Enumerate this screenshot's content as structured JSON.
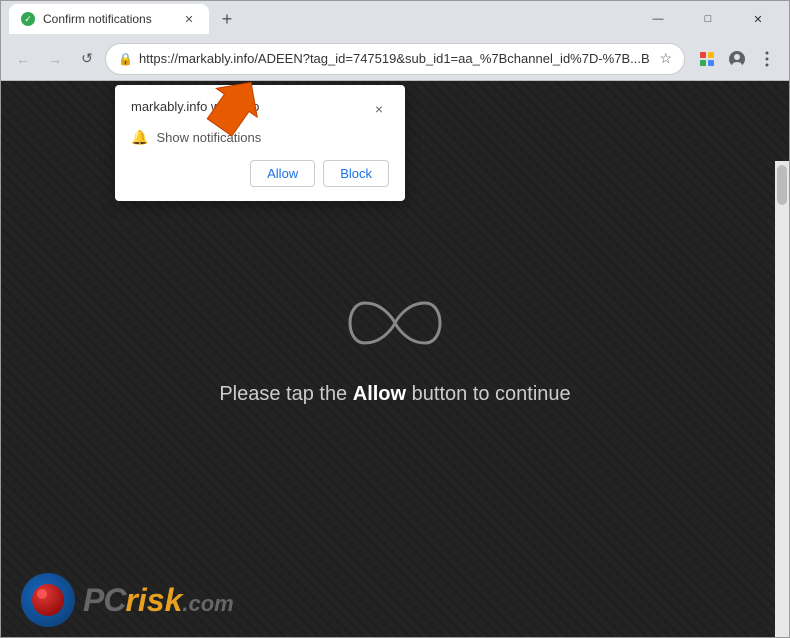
{
  "browser": {
    "title": "Confirm notifications",
    "url": "https://markably.info/ADEEN?tag_id=747519&sub_id1=aa_%7Bchannel_id%7D-%7B...B",
    "favicon_color": "#34a853",
    "new_tab_label": "+",
    "nav": {
      "back": "←",
      "forward": "→",
      "reload": "↺"
    },
    "window_controls": {
      "minimize": "—",
      "maximize": "□",
      "close": "✕"
    }
  },
  "popup": {
    "title": "markably.info wants to",
    "notification_label": "Show notifications",
    "close_label": "×",
    "allow_label": "Allow",
    "block_label": "Block"
  },
  "page": {
    "message": "Please tap the ",
    "message_bold": "Allow",
    "message_end": " button to continue"
  },
  "logo": {
    "pc_text": "PC",
    "risk_text": "risk",
    "dot_com": ".com"
  }
}
